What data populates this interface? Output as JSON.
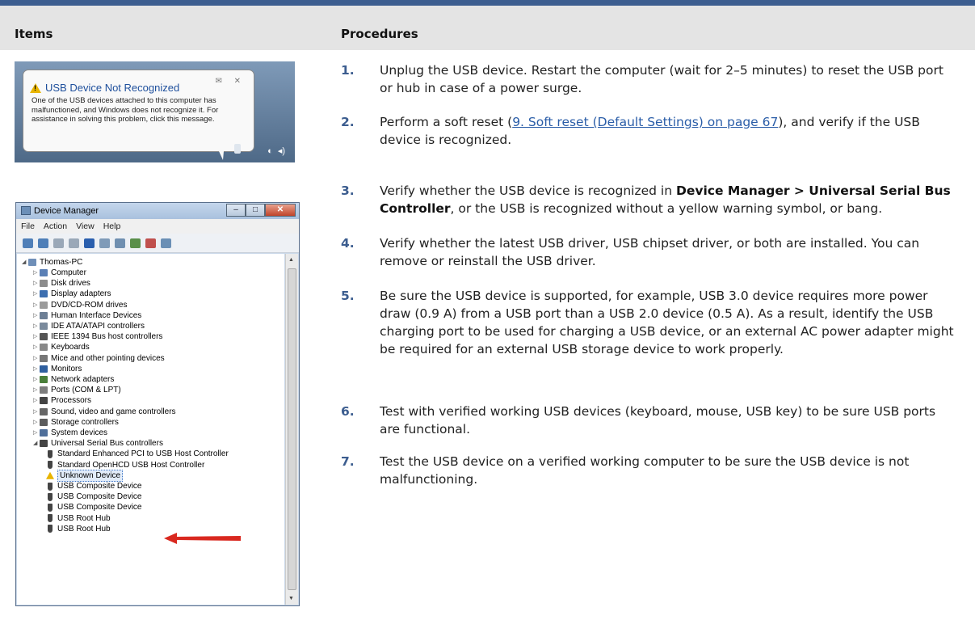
{
  "header": {
    "items_label": "Items",
    "procedures_label": "Procedures"
  },
  "balloon": {
    "title": "USB Device Not Recognized",
    "body": "One of the USB devices attached to this computer has malfunctioned, and Windows does not recognize it. For assistance in solving this problem, click this message.",
    "controls": "✉ ✕"
  },
  "device_manager": {
    "window_title": "Device Manager",
    "menu": [
      "File",
      "Action",
      "View",
      "Help"
    ],
    "root": "Thomas-PC",
    "categories": [
      {
        "label": "Computer",
        "icon_color": "#5a7fb5"
      },
      {
        "label": "Disk drives",
        "icon_color": "#8c8c8c"
      },
      {
        "label": "Display adapters",
        "icon_color": "#3d6fb0"
      },
      {
        "label": "DVD/CD-ROM drives",
        "icon_color": "#9b9b9b"
      },
      {
        "label": "Human Interface Devices",
        "icon_color": "#6d7f95"
      },
      {
        "label": "IDE ATA/ATAPI controllers",
        "icon_color": "#7a8a9c"
      },
      {
        "label": "IEEE 1394 Bus host controllers",
        "icon_color": "#555555"
      },
      {
        "label": "Keyboards",
        "icon_color": "#888888"
      },
      {
        "label": "Mice and other pointing devices",
        "icon_color": "#777777"
      },
      {
        "label": "Monitors",
        "icon_color": "#2f5f9e"
      },
      {
        "label": "Network adapters",
        "icon_color": "#4a7f3a"
      },
      {
        "label": "Ports (COM & LPT)",
        "icon_color": "#7d7d7d"
      },
      {
        "label": "Processors",
        "icon_color": "#444444"
      },
      {
        "label": "Sound, video and game controllers",
        "icon_color": "#666666"
      },
      {
        "label": "Storage controllers",
        "icon_color": "#5c5c5c"
      },
      {
        "label": "System devices",
        "icon_color": "#4f6f9a"
      },
      {
        "label": "Universal Serial Bus controllers",
        "icon_color": "#444444"
      }
    ],
    "usb_children": [
      "Standard Enhanced PCI to USB Host Controller",
      "Standard OpenHCD USB Host Controller",
      "Unknown Device",
      "USB Composite Device",
      "USB Composite Device",
      "USB Composite Device",
      "USB Root Hub",
      "USB Root Hub"
    ]
  },
  "procedures": [
    {
      "num": "1.",
      "text": "Unplug the USB device. Restart the computer (wait for 2–5 minutes) to reset the USB port or hub in case of a power surge."
    },
    {
      "num": "2.",
      "pre": "Perform a soft reset (",
      "link": "9. Soft reset (Default Settings) on page 67",
      "post": "), and verify if the USB device is recognized."
    },
    {
      "num": "3.",
      "pre": "Verify whether the USB device is recognized in ",
      "bold": "Device Manager > Universal Serial Bus Controller",
      "post": ", or the USB is recognized without a yellow warning symbol, or bang."
    },
    {
      "num": "4.",
      "text": "Verify whether the latest USB driver, USB chipset driver, or both are installed. You can remove or reinstall the USB driver."
    },
    {
      "num": "5.",
      "text": "Be sure the USB device is supported, for example, USB 3.0 device requires more power draw (0.9 A) from a USB port than a USB 2.0 device (0.5 A). As a result, identify the USB charging port to be used for charging a USB device, or an external AC power adapter might be required for an external USB storage device to work properly."
    },
    {
      "num": "6.",
      "text": "Test with verified working USB devices (keyboard, mouse, USB key) to be sure USB ports are functional."
    },
    {
      "num": "7.",
      "text": "Test the USB device on a verified working computer to be sure the USB device is not malfunctioning."
    }
  ]
}
